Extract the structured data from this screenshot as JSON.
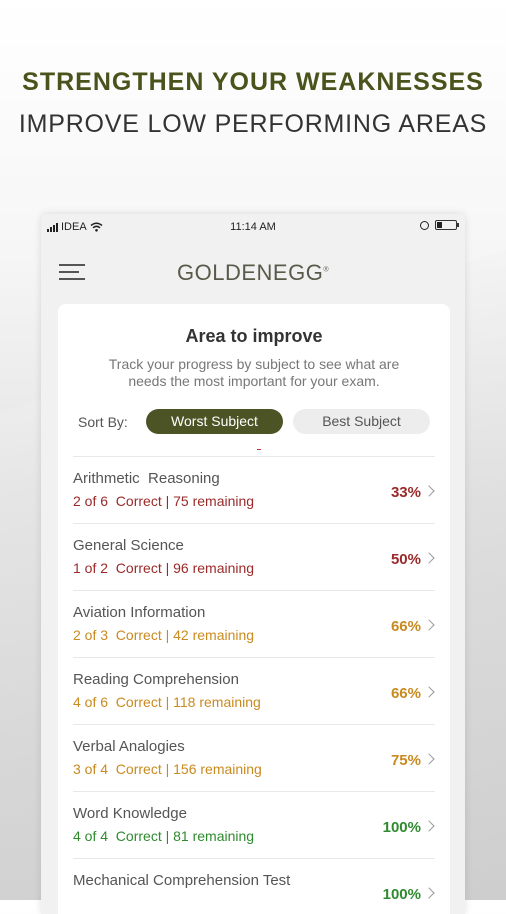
{
  "promo": {
    "headline": "STRENGTHEN YOUR WEAKNESSES",
    "subheadline": "IMPROVE LOW PERFORMING AREAS"
  },
  "status_bar": {
    "carrier": "IDEA",
    "time": "11:14 AM",
    "icons": [
      "signal-icon",
      "wifi-icon",
      "rotation-lock-icon",
      "battery-icon"
    ]
  },
  "app": {
    "logo_text": "GOLDENEGG",
    "logo_mark": "®",
    "menu_icon": "hamburger-menu-icon"
  },
  "card": {
    "title": "Area to improve",
    "description": "Track your progress by subject to see what are needs the most important for your exam.",
    "sort_label": "Sort By:",
    "sort_options": [
      {
        "label": "Worst Subject",
        "active": true
      },
      {
        "label": "Best Subject",
        "active": false
      }
    ]
  },
  "colors": {
    "accent": "#4c5426",
    "headline": "#4a531c",
    "low": "#9b2a2a",
    "mid": "#c98a1f",
    "high": "#2e8b2e"
  },
  "subjects": [
    {
      "name": "Arithmetic  Reasoning",
      "detail": "2 of 6  Correct | 75 remaining",
      "percent": "33%",
      "level": "low"
    },
    {
      "name": "General Science",
      "detail": "1 of 2  Correct | 96 remaining",
      "percent": "50%",
      "level": "low"
    },
    {
      "name": "Aviation Information",
      "detail": "2 of 3  Correct | 42 remaining",
      "percent": "66%",
      "level": "mid"
    },
    {
      "name": "Reading Comprehension",
      "detail": "4 of 6  Correct | 118 remaining",
      "percent": "66%",
      "level": "mid"
    },
    {
      "name": "Verbal Analogies",
      "detail": "3 of 4  Correct | 156 remaining",
      "percent": "75%",
      "level": "mid"
    },
    {
      "name": "Word Knowledge",
      "detail": "4 of 4  Correct | 81 remaining",
      "percent": "100%",
      "level": "high"
    },
    {
      "name": "Mechanical Comprehension Test",
      "detail": "",
      "percent": "100%",
      "level": "high"
    }
  ]
}
